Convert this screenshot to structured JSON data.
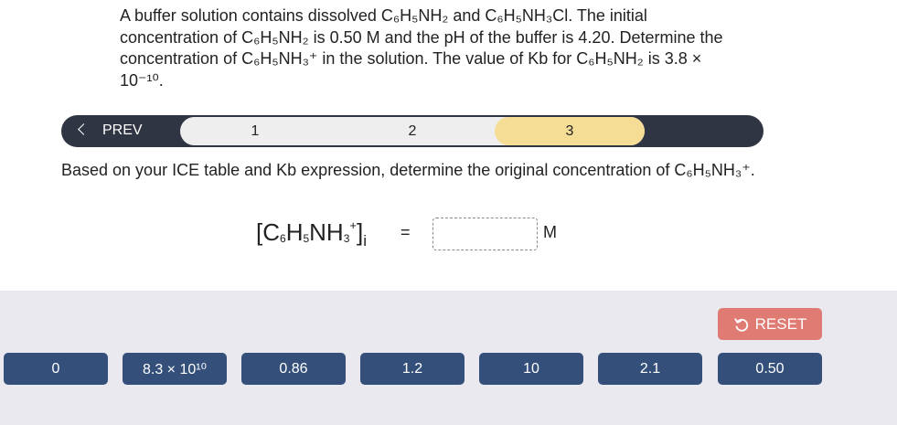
{
  "question": {
    "text": "A buffer solution contains dissolved C₆H₅NH₂ and C₆H₅NH₃Cl. The initial concentration of C₆H₅NH₂ is 0.50 M and the pH of the buffer is 4.20. Determine the concentration of C₆H₅NH₃⁺ in the solution. The value of Kb for C₆H₅NH₂ is 3.8 × 10⁻¹⁰."
  },
  "stepper": {
    "prev_label": "PREV",
    "steps": [
      "1",
      "2",
      "3"
    ],
    "active_step": "3",
    "colors": {
      "bar": "#2f3542",
      "track": "#eeeeee",
      "active": "#f5dd96"
    }
  },
  "prompt": {
    "text": "Based on your ICE table and Kb expression, determine the original concentration of C₆H₅NH₃⁺."
  },
  "equation": {
    "open_bracket": "[C",
    "sub6": "6",
    "h": "H",
    "sub5": "5",
    "nh": "NH",
    "sub3": "3",
    "sup_plus": "+",
    "close_bracket": "]",
    "sub_i": "i",
    "equals": "=",
    "answer_value": "",
    "unit": "M"
  },
  "tray": {
    "reset_label": "RESET",
    "reset_icon": "undo-icon",
    "tiles": [
      "0",
      "8.3 × 10¹⁰",
      "0.86",
      "1.2",
      "10",
      "2.1",
      "0.50"
    ],
    "colors": {
      "background": "#e9e9ef",
      "tile": "#34507a",
      "reset": "#e07b73"
    }
  }
}
